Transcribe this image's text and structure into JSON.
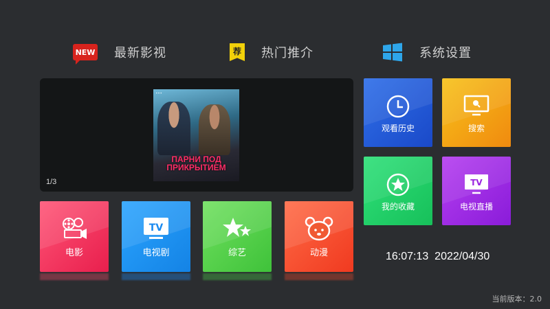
{
  "nav": {
    "new": {
      "icon": "new-badge-icon",
      "badge_text": "NEW",
      "label": "最新影视"
    },
    "hot": {
      "icon": "recommend-badge-icon",
      "badge_text": "荐",
      "label": "热门推介"
    },
    "settings": {
      "icon": "windows-icon",
      "label": "系统设置"
    }
  },
  "banner": {
    "counter": "1/3",
    "poster": {
      "title_line1": "ПАРНИ ПОД",
      "title_line2": "ПРИКРЫТИЕМ"
    }
  },
  "categories": [
    {
      "label": "电影",
      "icon": "film-reel-icon",
      "color": "#ff4d6d"
    },
    {
      "label": "电视剧",
      "icon": "tv-icon",
      "color": "#1e90ff"
    },
    {
      "label": "综艺",
      "icon": "stars-icon",
      "color": "#4cd44a"
    },
    {
      "label": "动漫",
      "icon": "bear-face-icon",
      "color": "#f5492b"
    }
  ],
  "tiles": {
    "history": {
      "label": "观看历史",
      "icon": "clock-icon",
      "color": "#2256d8"
    },
    "search": {
      "label": "搜索",
      "icon": "monitor-search-icon",
      "color": "#f5a214"
    },
    "favorites": {
      "label": "我的收藏",
      "icon": "star-circle-icon",
      "color": "#22d16a"
    },
    "live": {
      "label": "电视直播",
      "icon": "tv-live-icon",
      "color": "#a02de6"
    }
  },
  "status": {
    "time": "16:07:13",
    "date": "2022/04/30",
    "version": "当前版本：2.0"
  }
}
